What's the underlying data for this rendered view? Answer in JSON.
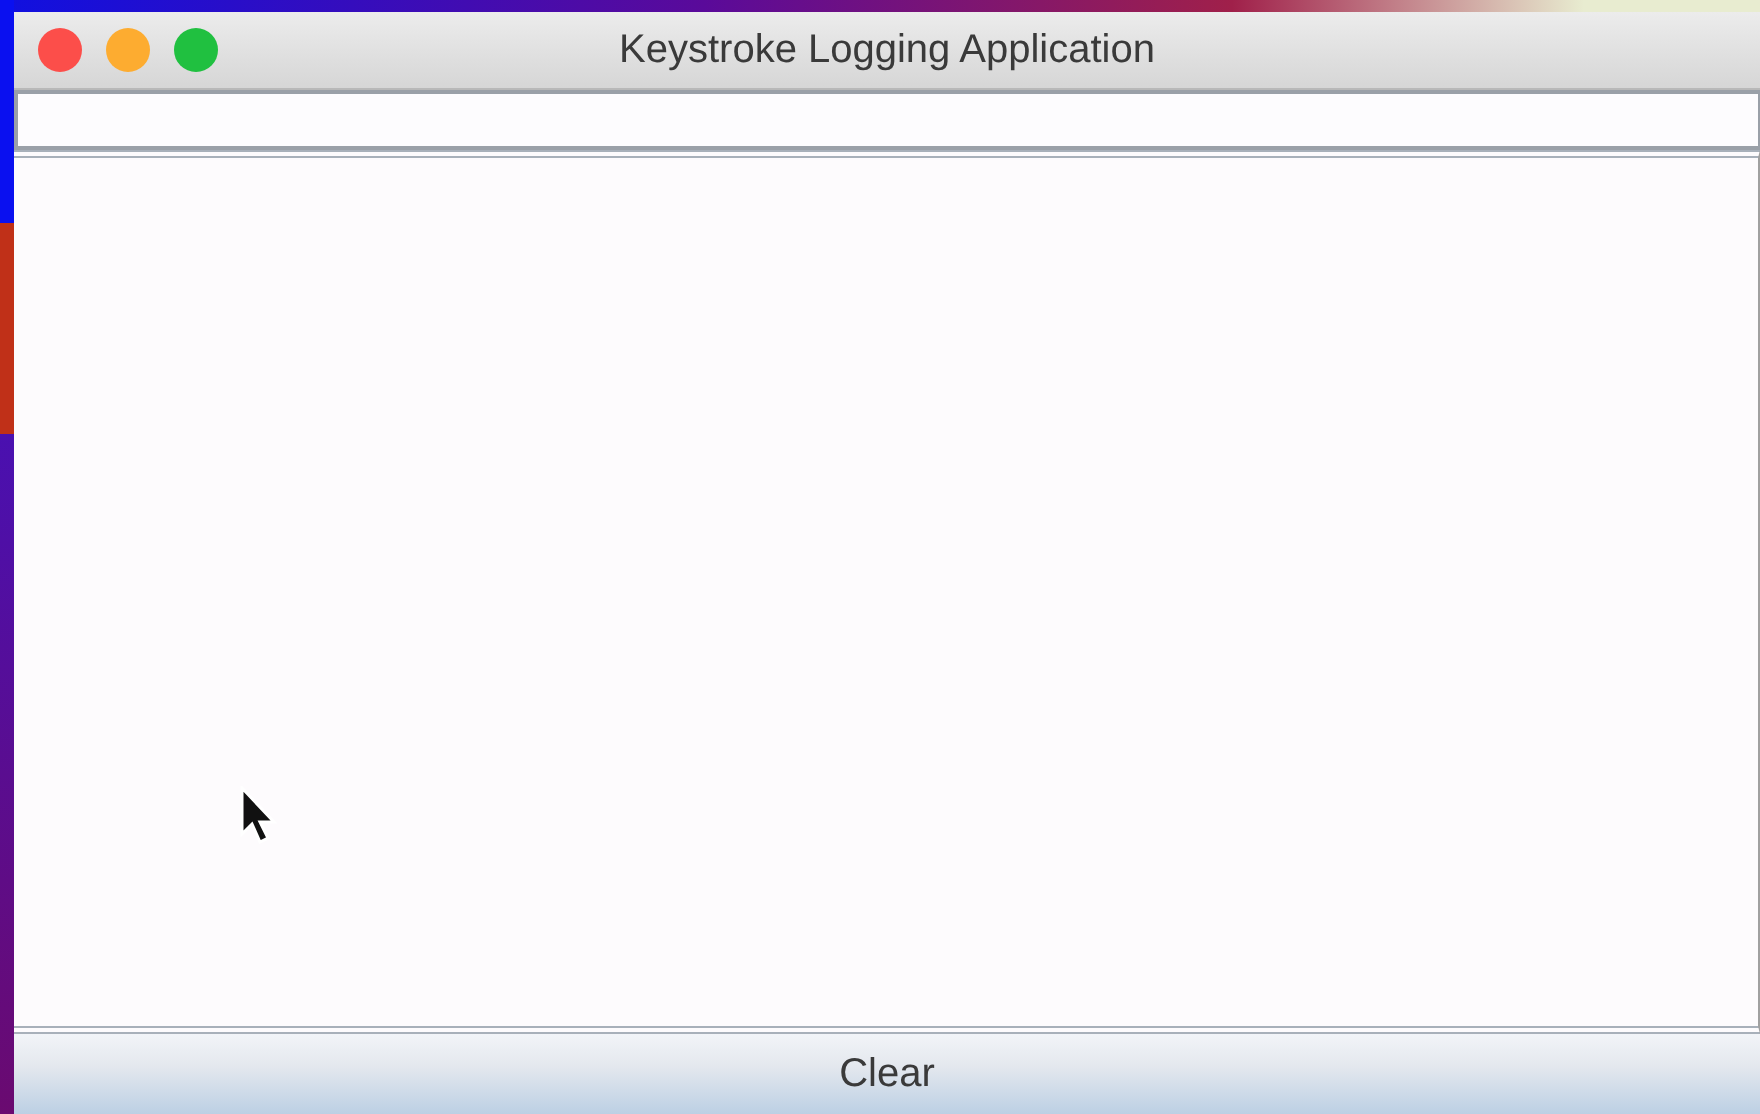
{
  "window": {
    "title": "Keystroke Logging Application"
  },
  "buttons": [
    {
      "label": "Clear"
    }
  ]
}
